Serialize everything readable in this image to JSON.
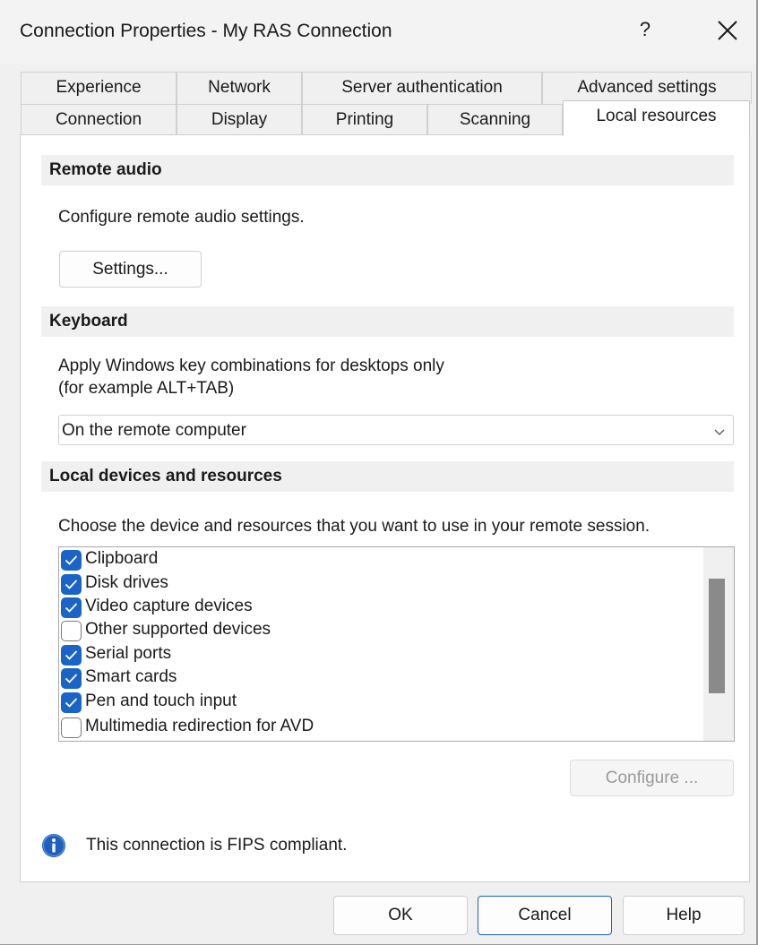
{
  "window": {
    "title": "Connection Properties - My RAS Connection",
    "help_glyph": "?",
    "close_glyph": "×"
  },
  "tabs": {
    "row1": [
      "Experience",
      "Network",
      "Server authentication",
      "Advanced settings"
    ],
    "row2": [
      "Connection",
      "Display",
      "Printing",
      "Scanning"
    ],
    "active": "Local resources"
  },
  "remote_audio": {
    "header": "Remote audio",
    "description": "Configure remote audio settings.",
    "settings_button": "Settings..."
  },
  "keyboard": {
    "header": "Keyboard",
    "description_line1": "Apply Windows key combinations for desktops only",
    "description_line2": "(for example ALT+TAB)",
    "selected_option": "On the remote computer"
  },
  "local_devices": {
    "header": "Local devices and resources",
    "description": "Choose the device and resources that you want to use in your remote session.",
    "items": [
      {
        "label": "Clipboard",
        "checked": true
      },
      {
        "label": "Disk drives",
        "checked": true
      },
      {
        "label": "Video capture devices",
        "checked": true
      },
      {
        "label": "Other supported devices",
        "checked": false
      },
      {
        "label": "Serial ports",
        "checked": true
      },
      {
        "label": "Smart cards",
        "checked": true
      },
      {
        "label": "Pen and touch input",
        "checked": true
      },
      {
        "label": "Multimedia redirection for AVD",
        "checked": false
      }
    ],
    "configure_button": "Configure ..."
  },
  "fips": {
    "text": "This connection is FIPS compliant."
  },
  "footer": {
    "ok": "OK",
    "cancel": "Cancel",
    "help": "Help"
  },
  "colors": {
    "accent": "#1a64c8",
    "info_icon": "#1e5fc0"
  }
}
